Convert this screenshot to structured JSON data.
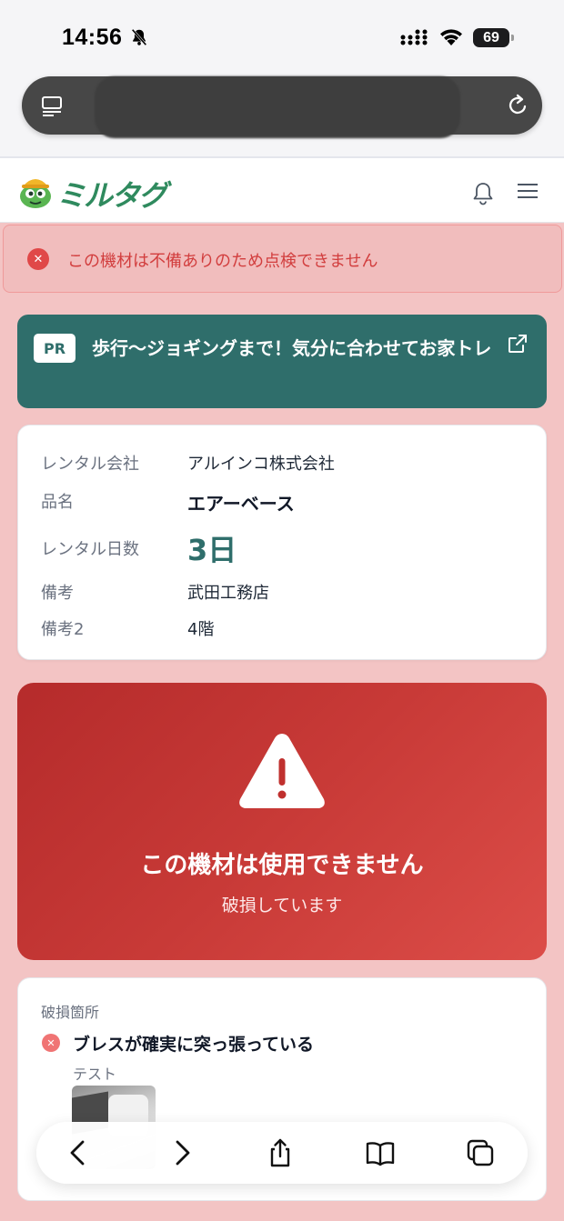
{
  "status_bar": {
    "time": "14:56",
    "battery": "69"
  },
  "app": {
    "brand": "ミルタグ",
    "brand_color": "#2f8a5e"
  },
  "alert": {
    "message": "この機材は不備ありのため点検できません"
  },
  "pr_banner": {
    "badge": "PR",
    "text": "歩行〜ジョギングまで！気分に合わせてお家トレ"
  },
  "info": {
    "rows": [
      {
        "label": "レンタル会社",
        "value": "アルインコ株式会社"
      },
      {
        "label": "品名",
        "value": "エアーベース"
      },
      {
        "label": "レンタル日数",
        "value": "3日"
      },
      {
        "label": "備考",
        "value": "武田工務店"
      },
      {
        "label": "備考2",
        "value": "4階"
      }
    ]
  },
  "danger": {
    "title": "この機材は使用できません",
    "subtitle": "破損しています"
  },
  "damage": {
    "section_label": "破損箇所",
    "item_title": "ブレスが確実に突っ張っている",
    "item_note": "テスト"
  },
  "colors": {
    "page_bg": "#f3c4c4",
    "teal": "#2f6e6b",
    "danger": "#c83a37",
    "alert_text": "#d23e3e"
  }
}
